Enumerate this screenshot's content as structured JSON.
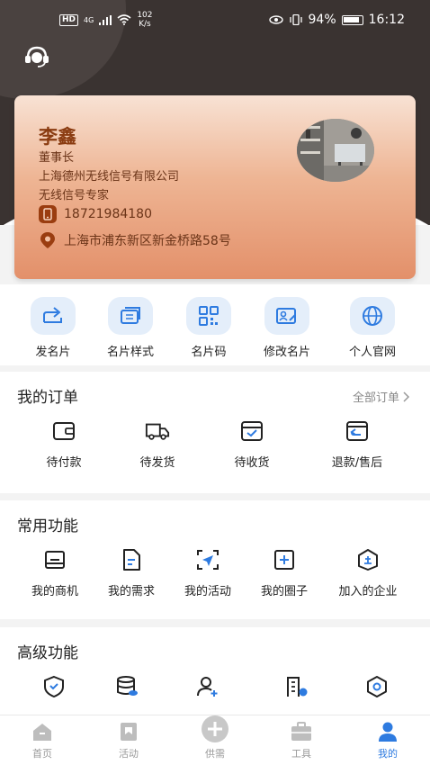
{
  "status_bar": {
    "hd": "HD",
    "network": "4G",
    "speed_value": "102",
    "speed_unit": "K/s",
    "battery": "94%",
    "time": "16:12"
  },
  "card": {
    "name": "李鑫",
    "title": "董事长",
    "company": "上海德州无线信号有限公司",
    "role": "无线信号专家",
    "phone": "18721984180",
    "address": "上海市浦东新区新金桥路58号"
  },
  "quick_actions": [
    {
      "label": "发名片",
      "icon": "share-icon"
    },
    {
      "label": "名片样式",
      "icon": "card-style-icon"
    },
    {
      "label": "名片码",
      "icon": "qr-code-icon"
    },
    {
      "label": "修改名片",
      "icon": "edit-card-icon"
    },
    {
      "label": "个人官网",
      "icon": "globe-icon"
    }
  ],
  "orders": {
    "title": "我的订单",
    "all_label": "全部订单",
    "items": [
      {
        "label": "待付款",
        "icon": "wallet-icon"
      },
      {
        "label": "待发货",
        "icon": "truck-icon"
      },
      {
        "label": "待收货",
        "icon": "box-check-icon"
      },
      {
        "label": "退款/售后",
        "icon": "refund-icon"
      }
    ]
  },
  "common": {
    "title": "常用功能",
    "items": [
      {
        "label": "我的商机",
        "icon": "inbox-icon"
      },
      {
        "label": "我的需求",
        "icon": "document-icon"
      },
      {
        "label": "我的活动",
        "icon": "send-icon"
      },
      {
        "label": "我的圈子",
        "icon": "plus-square-icon"
      },
      {
        "label": "加入的企业",
        "icon": "enterprise-icon"
      }
    ]
  },
  "advanced": {
    "title": "高级功能",
    "items": [
      {
        "icon": "shield-check-icon"
      },
      {
        "icon": "database-icon"
      },
      {
        "icon": "add-user-icon"
      },
      {
        "icon": "building-icon"
      },
      {
        "icon": "hexagon-icon"
      }
    ]
  },
  "tabs": [
    {
      "label": "首页",
      "icon": "home-icon"
    },
    {
      "label": "活动",
      "icon": "bookmark-icon"
    },
    {
      "label": "供需",
      "icon": "plus-circle-icon"
    },
    {
      "label": "工具",
      "icon": "briefcase-icon"
    },
    {
      "label": "我的",
      "icon": "person-icon",
      "active": true
    }
  ],
  "colors": {
    "accent": "#2e7be0",
    "card_gradient_start": "#f8e2d4",
    "card_gradient_end": "#e3906a",
    "header_bg": "#3a3331"
  }
}
